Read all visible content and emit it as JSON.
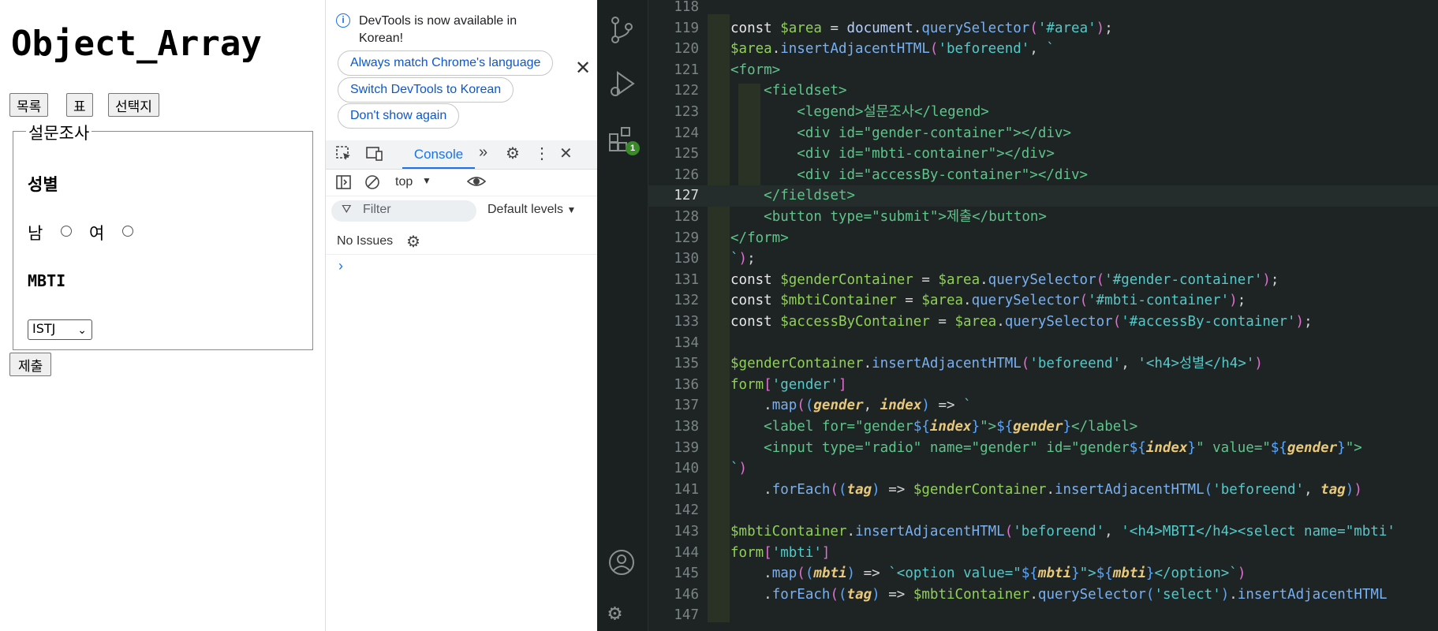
{
  "page": {
    "title": "Object_Array",
    "nav_buttons": [
      "목록",
      "표",
      "선택지"
    ],
    "legend": "설문조사",
    "gender_heading": "성별",
    "gender_options": [
      "남",
      "여"
    ],
    "mbti_heading": "MBTI",
    "mbti_selected": "ISTJ",
    "submit_label": "제출"
  },
  "devtools": {
    "info_message": "DevTools is now available in Korean!",
    "buttons": [
      "Always match Chrome's language",
      "Switch DevTools to Korean",
      "Don't show again"
    ],
    "tab_console": "Console",
    "context": "top",
    "filter_placeholder": "Filter",
    "levels": "Default levels",
    "issues": "No Issues",
    "prompt": "›"
  },
  "vscode": {
    "extensions_badge": "1",
    "current_line": 127,
    "code_lines": [
      {
        "n": "118",
        "html": ""
      },
      {
        "n": "119",
        "html": "<span class=\"k\">const</span> <span class=\"v\">$area</span> = <span class=\"p\">document</span>.<span class=\"f\">querySelector</span><span class=\"b2\">(</span><span class=\"s\">'#area'</span><span class=\"b2\">)</span>;"
      },
      {
        "n": "120",
        "html": "<span class=\"v\">$area</span>.<span class=\"f\">insertAdjacentHTML</span><span class=\"b2\">(</span><span class=\"s\">'beforeend'</span>, <span class=\"s\">`</span>"
      },
      {
        "n": "121",
        "html": "<span class=\"t\">&lt;form&gt;</span>"
      },
      {
        "n": "122",
        "html": "    <span class=\"t\">&lt;fieldset&gt;</span>"
      },
      {
        "n": "123",
        "html": "        <span class=\"t\">&lt;legend&gt;설문조사&lt;/legend&gt;</span>"
      },
      {
        "n": "124",
        "html": "        <span class=\"t\">&lt;div id=\"gender-container\"&gt;&lt;/div&gt;</span>"
      },
      {
        "n": "125",
        "html": "        <span class=\"t\">&lt;div id=\"mbti-container\"&gt;&lt;/div&gt;</span>"
      },
      {
        "n": "126",
        "html": "        <span class=\"t\">&lt;div id=\"accessBy-container\"&gt;&lt;/div&gt;</span>"
      },
      {
        "n": "127",
        "html": "    <span class=\"t\">&lt;/fieldset&gt;</span>"
      },
      {
        "n": "128",
        "html": "    <span class=\"t\">&lt;button type=\"submit\"&gt;제출&lt;/button&gt;</span>"
      },
      {
        "n": "129",
        "html": "<span class=\"t\">&lt;/form&gt;</span>"
      },
      {
        "n": "130",
        "html": "<span class=\"s\">`</span><span class=\"b2\">)</span>;"
      },
      {
        "n": "131",
        "html": "<span class=\"k\">const</span> <span class=\"v\">$genderContainer</span> = <span class=\"v\">$area</span>.<span class=\"f\">querySelector</span><span class=\"b2\">(</span><span class=\"s\">'#gender-container'</span><span class=\"b2\">)</span>;"
      },
      {
        "n": "132",
        "html": "<span class=\"k\">const</span> <span class=\"v\">$mbtiContainer</span> = <span class=\"v\">$area</span>.<span class=\"f\">querySelector</span><span class=\"b2\">(</span><span class=\"s\">'#mbti-container'</span><span class=\"b2\">)</span>;"
      },
      {
        "n": "133",
        "html": "<span class=\"k\">const</span> <span class=\"v\">$accessByContainer</span> = <span class=\"v\">$area</span>.<span class=\"f\">querySelector</span><span class=\"b2\">(</span><span class=\"s\">'#accessBy-container'</span><span class=\"b2\">)</span>;"
      },
      {
        "n": "134",
        "html": ""
      },
      {
        "n": "135",
        "html": "<span class=\"v\">$genderContainer</span>.<span class=\"f\">insertAdjacentHTML</span><span class=\"b2\">(</span><span class=\"s\">'beforeend'</span>, <span class=\"s\">'&lt;h4&gt;성별&lt;/h4&gt;'</span><span class=\"b2\">)</span>"
      },
      {
        "n": "136",
        "html": "<span class=\"v\">form</span><span class=\"b2\">[</span><span class=\"s\">'gender'</span><span class=\"b2\">]</span>"
      },
      {
        "n": "137",
        "html": "    .<span class=\"f\">map</span><span class=\"b2\">(</span><span class=\"b3\">(</span><span class=\"it\">gender</span>, <span class=\"it\">index</span><span class=\"b3\">)</span> =&gt; <span class=\"s\">`</span>"
      },
      {
        "n": "138",
        "html": "    <span class=\"t\">&lt;label for=\"gender</span><span class=\"b3\">${</span><span class=\"it\">index</span><span class=\"b3\">}</span><span class=\"t\">\"&gt;</span><span class=\"b3\">${</span><span class=\"it\">gender</span><span class=\"b3\">}</span><span class=\"t\">&lt;/label&gt;</span>"
      },
      {
        "n": "139",
        "html": "    <span class=\"t\">&lt;input type=\"radio\" name=\"gender\" id=\"gender</span><span class=\"b3\">${</span><span class=\"it\">index</span><span class=\"b3\">}</span><span class=\"t\">\" value=\"</span><span class=\"b3\">${</span><span class=\"it\">gender</span><span class=\"b3\">}</span><span class=\"t\">\"&gt;</span>"
      },
      {
        "n": "140",
        "html": "<span class=\"s\">`</span><span class=\"b2\">)</span>"
      },
      {
        "n": "141",
        "html": "    .<span class=\"f\">forEach</span><span class=\"b2\">(</span><span class=\"b3\">(</span><span class=\"it\">tag</span><span class=\"b3\">)</span> =&gt; <span class=\"v\">$genderContainer</span>.<span class=\"f\">insertAdjacentHTML</span><span class=\"b3\">(</span><span class=\"s\">'beforeend'</span>, <span class=\"it\">tag</span><span class=\"b3\">)</span><span class=\"b2\">)</span>"
      },
      {
        "n": "142",
        "html": ""
      },
      {
        "n": "143",
        "html": "<span class=\"v\">$mbtiContainer</span>.<span class=\"f\">insertAdjacentHTML</span><span class=\"b2\">(</span><span class=\"s\">'beforeend'</span>, <span class=\"s\">'&lt;h4&gt;MBTI&lt;/h4&gt;&lt;select name=\"mbti'</span>"
      },
      {
        "n": "144",
        "html": "<span class=\"v\">form</span><span class=\"b2\">[</span><span class=\"s\">'mbti'</span><span class=\"b2\">]</span>"
      },
      {
        "n": "145",
        "html": "    .<span class=\"f\">map</span><span class=\"b2\">(</span><span class=\"b3\">(</span><span class=\"it\">mbti</span><span class=\"b3\">)</span> =&gt; <span class=\"s\">`&lt;option value=\"</span><span class=\"b3\">${</span><span class=\"it\">mbti</span><span class=\"b3\">}</span><span class=\"s\">\"&gt;</span><span class=\"b3\">${</span><span class=\"it\">mbti</span><span class=\"b3\">}</span><span class=\"s\">&lt;/option&gt;`</span><span class=\"b2\">)</span>"
      },
      {
        "n": "146",
        "html": "    .<span class=\"f\">forEach</span><span class=\"b2\">(</span><span class=\"b3\">(</span><span class=\"it\">tag</span><span class=\"b3\">)</span> =&gt; <span class=\"v\">$mbtiContainer</span>.<span class=\"f\">querySelector</span><span class=\"b3\">(</span><span class=\"s\">'select'</span><span class=\"b3\">)</span>.<span class=\"f\">insertAdjacentHTML</span>"
      },
      {
        "n": "147",
        "html": ""
      }
    ]
  }
}
